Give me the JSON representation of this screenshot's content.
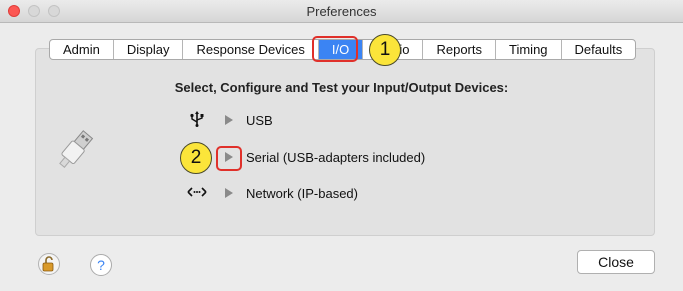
{
  "window": {
    "title": "Preferences"
  },
  "tabs": [
    {
      "label": "Admin",
      "active": false
    },
    {
      "label": "Display",
      "active": false
    },
    {
      "label": "Response Devices",
      "active": false
    },
    {
      "label": "I/O",
      "active": true
    },
    {
      "label": "Audio",
      "active": false
    },
    {
      "label": "Reports",
      "active": false
    },
    {
      "label": "Timing",
      "active": false
    },
    {
      "label": "Defaults",
      "active": false
    }
  ],
  "panel": {
    "heading": "Select, Configure and Test your Input/Output Devices:",
    "devices": [
      {
        "label": "USB",
        "icon": "usb-symbol-icon",
        "expanded": false
      },
      {
        "label": "Serial (USB-adapters included)",
        "icon": "none",
        "expanded": false
      },
      {
        "label": "Network (IP-based)",
        "icon": "network-arrows-icon",
        "expanded": false
      }
    ]
  },
  "annotations": [
    {
      "number": "1",
      "target": "I/O tab"
    },
    {
      "number": "2",
      "target": "Serial disclosure arrow"
    }
  ],
  "footer": {
    "help_label": "?",
    "close_label": "Close"
  },
  "colors": {
    "accent": "#3b84f3",
    "highlight": "#e0302a",
    "badge": "#fbe53a"
  }
}
